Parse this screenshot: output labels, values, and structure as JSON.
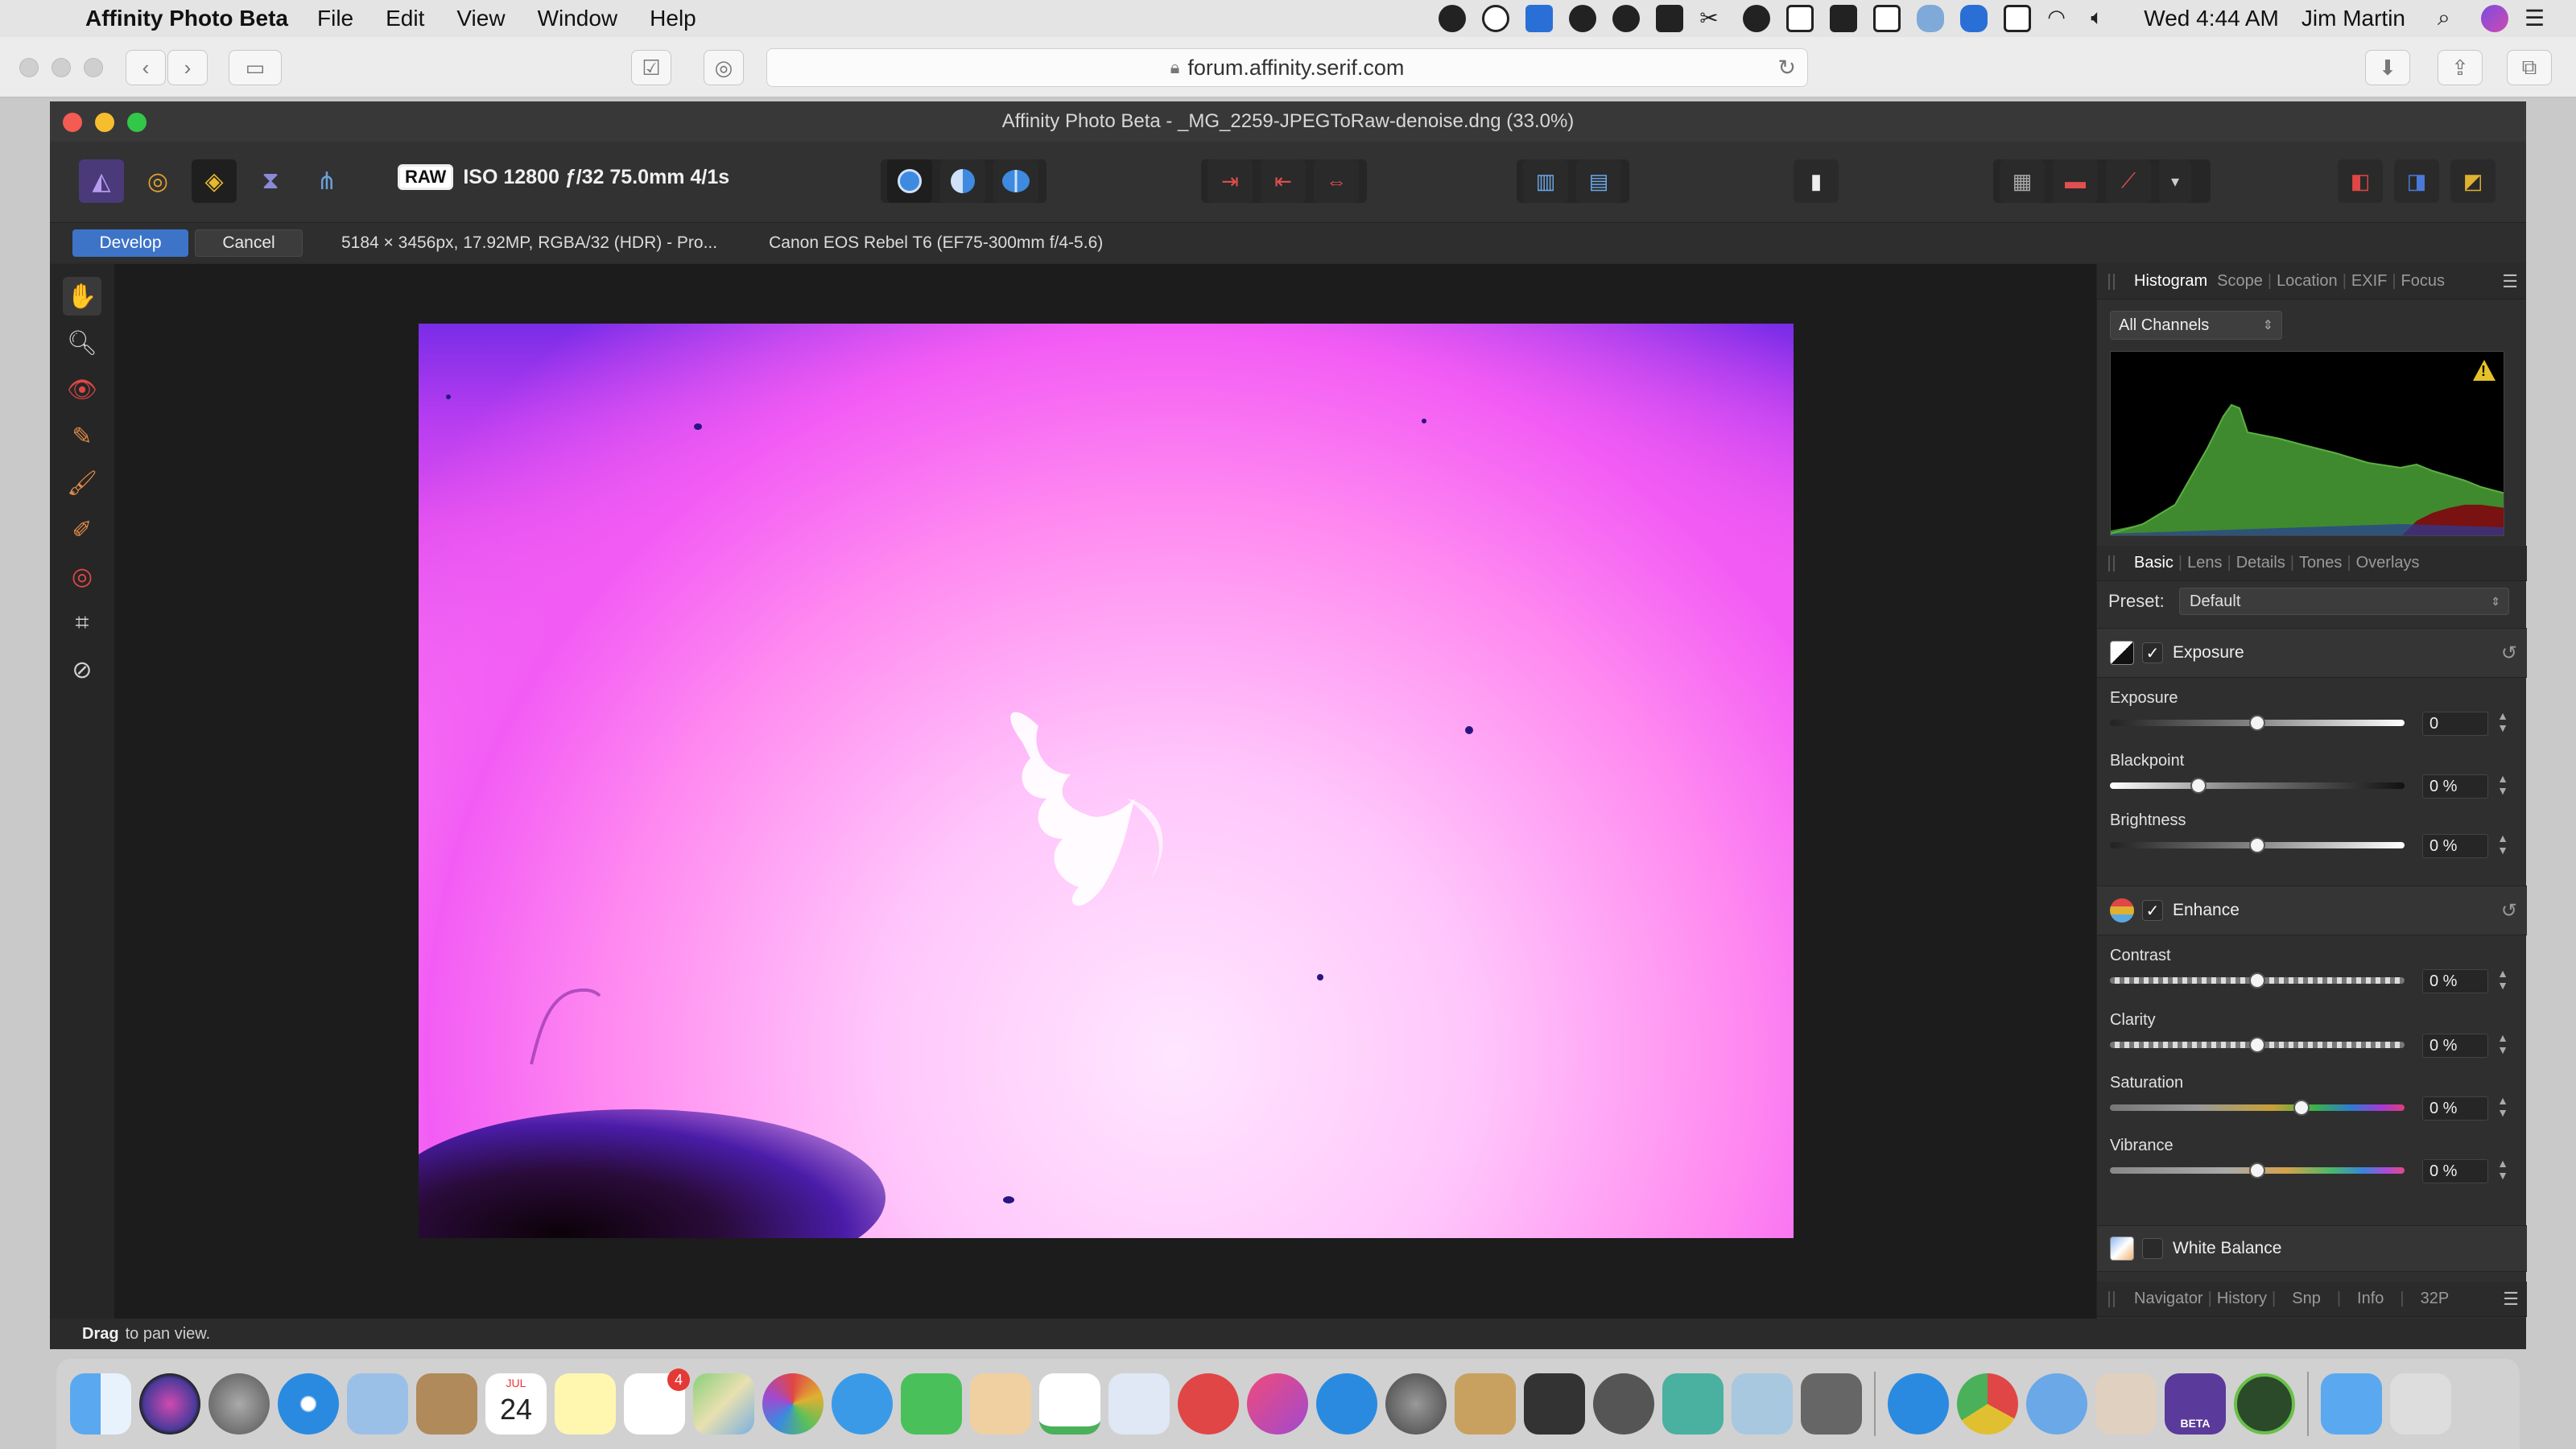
{
  "menubar": {
    "app_name": "Affinity Photo Beta",
    "menus": [
      "File",
      "Edit",
      "View",
      "Window",
      "Help"
    ],
    "clock": "Wed 4:44 AM",
    "user": "Jim Martin"
  },
  "safari": {
    "url": "forum.affinity.serif.com"
  },
  "window": {
    "title": "Affinity Photo Beta - _MG_2259-JPEGToRaw-denoise.dng (33.0%)"
  },
  "toolbar": {
    "raw_badge": "RAW",
    "exif_summary": "ISO 12800 ƒ/32 75.0mm 4/1s"
  },
  "context": {
    "develop_label": "Develop",
    "cancel_label": "Cancel",
    "image_info": "5184 × 3456px, 17.92MP, RGBA/32 (HDR) - Pro...",
    "camera_info": "Canon EOS Rebel T6 (EF75-300mm f/4-5.6)"
  },
  "histogram_panel": {
    "tabs": [
      "Histogram",
      "Scope",
      "Location",
      "EXIF",
      "Focus"
    ],
    "channel": "All Channels",
    "warning_icon": "warning-triangle-icon"
  },
  "develop_panel": {
    "tabs": [
      "Basic",
      "Lens",
      "Details",
      "Tones",
      "Overlays"
    ],
    "preset_label": "Preset:",
    "preset_value": "Default",
    "exposure_section": {
      "title": "Exposure",
      "sliders": [
        {
          "label": "Exposure",
          "value": "0",
          "level": 0.5
        },
        {
          "label": "Blackpoint",
          "value": "0 %",
          "level": 0.3
        },
        {
          "label": "Brightness",
          "value": "0 %",
          "level": 0.5
        }
      ]
    },
    "enhance_section": {
      "title": "Enhance",
      "sliders": [
        {
          "label": "Contrast",
          "value": "0 %",
          "level": 0.5
        },
        {
          "label": "Clarity",
          "value": "0 %",
          "level": 0.5
        },
        {
          "label": "Saturation",
          "value": "0 %",
          "level": 0.65
        },
        {
          "label": "Vibrance",
          "value": "0 %",
          "level": 0.5
        }
      ]
    },
    "white_balance_section": {
      "title": "White Balance"
    }
  },
  "bottom_tabs": [
    "Navigator",
    "History",
    "Snp",
    "Info",
    "32P"
  ],
  "status": {
    "bold": "Drag",
    "text": "to pan view."
  },
  "dock": {
    "calendar_month": "JUL",
    "calendar_day": "24",
    "reminders_badge": "4",
    "beta_label": "BETA"
  },
  "colors": {
    "develop_button": "#3d74c8",
    "photo_top": "#7a2ce8",
    "photo_mid": "#f46ef2",
    "photo_bottom": "#ffe8ff",
    "histogram_green": "#3f8a2e",
    "histogram_red": "#7a1212"
  }
}
